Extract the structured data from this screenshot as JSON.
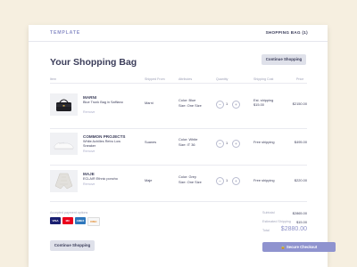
{
  "header": {
    "brand": "TEMPLATE",
    "bag_link": "SHOPPING BAG (1)"
  },
  "page": {
    "title": "Your Shopping Bag",
    "continue_label": "Continue Shopping"
  },
  "columns": [
    "Item",
    "Shipped From",
    "Attributes",
    "Quantity",
    "Shipping Cost",
    "Price"
  ],
  "items": [
    {
      "brand": "MARNI",
      "name": "Blue Trunk Bag in Saffiano",
      "remove": "Remove",
      "shipped_from": "Marni",
      "color": "Color: Blue",
      "size": "Size: One Size",
      "quantity": "1",
      "shipping_cost": "Est. shipping\n$15.00",
      "price": "$2150.00"
    },
    {
      "brand": "COMMON PROJECTS",
      "name": "White Achilles Retro Low Sneaker",
      "remove": "Remove",
      "shipped_from": "Suanes",
      "color": "Color: White",
      "size": "Size: IT 36",
      "quantity": "1",
      "shipping_cost": "Free shipping",
      "price": "$495.00"
    },
    {
      "brand": "MAJE",
      "name": "ECLAIR Ethnic poncho",
      "remove": "Remove",
      "shipped_from": "Maje",
      "color": "Color: Grey",
      "size": "Size: One Size",
      "quantity": "1",
      "shipping_cost": "Free shipping",
      "price": "$220.00"
    }
  ],
  "payment": {
    "label": "Accepted payment options",
    "methods": [
      "VISA",
      "MC",
      "AMEX",
      "DISC"
    ]
  },
  "summary": {
    "subtotal_label": "Subtotal",
    "subtotal": "$2865.00",
    "shipping_label": "Estimated Shipping",
    "shipping": "$15.00",
    "total_label": "Total",
    "total": "$2880.00"
  },
  "checkout_label": "Secure Checkout",
  "colors": {
    "accent": "#8f93cf",
    "background": "#f6efe0",
    "button_gray": "#dfe1ea"
  }
}
